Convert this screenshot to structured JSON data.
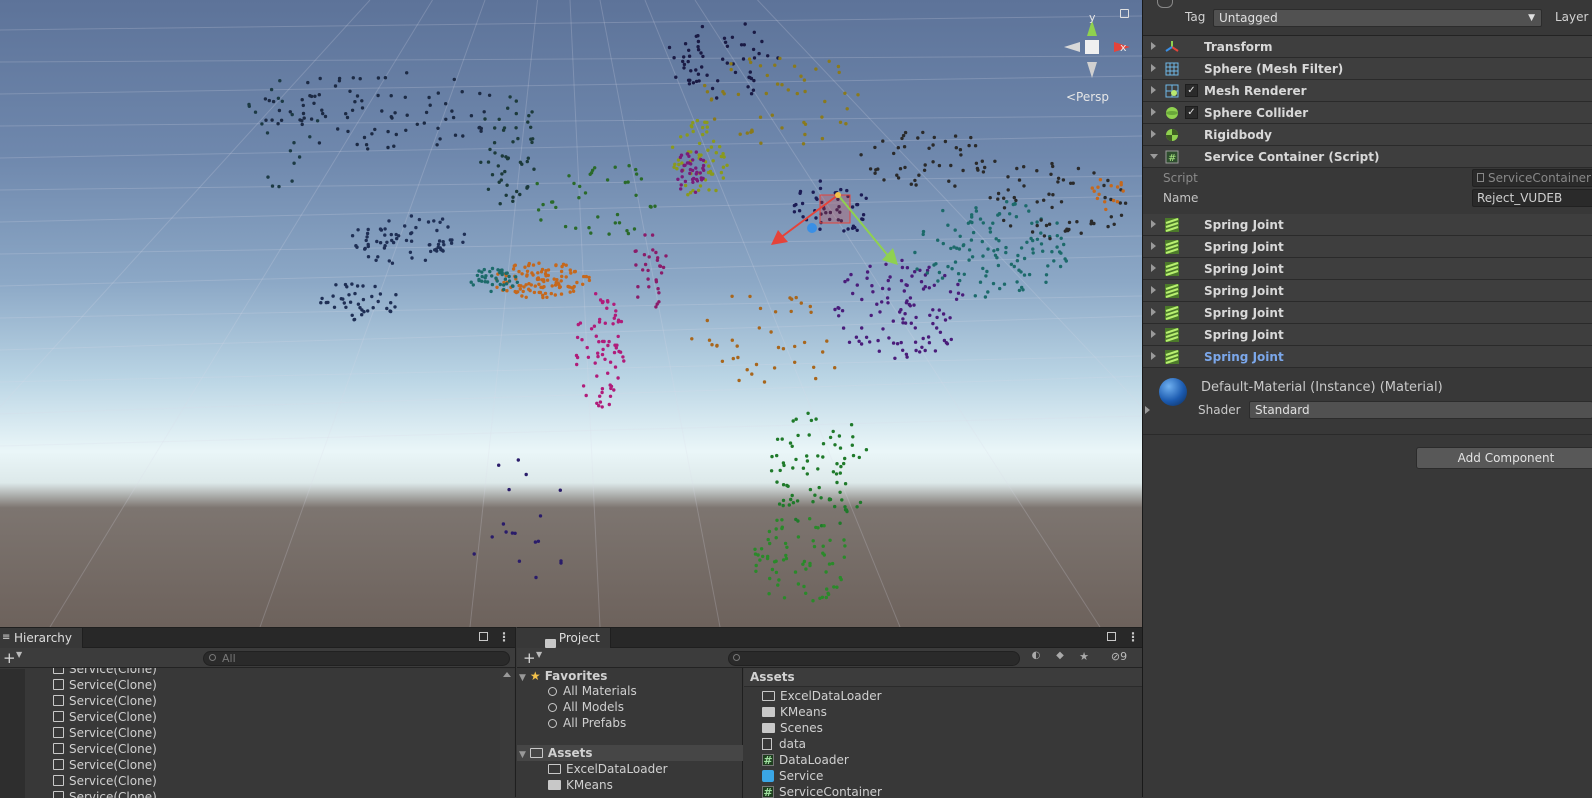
{
  "scene": {
    "persp_label": "<Persp",
    "gizmo_axes": {
      "y": "y",
      "x": "x"
    },
    "lock_icon": "lock-icon"
  },
  "inspector": {
    "tag_label": "Tag",
    "tag_value": "Untagged",
    "layer_label": "Layer",
    "components": [
      {
        "label": "Transform",
        "icon": "transform-icon",
        "checkbox": false,
        "open": false
      },
      {
        "label": "Sphere (Mesh Filter)",
        "icon": "mesh-filter-icon",
        "checkbox": false,
        "open": false
      },
      {
        "label": "Mesh Renderer",
        "icon": "mesh-renderer-icon",
        "checkbox": true,
        "open": false
      },
      {
        "label": "Sphere Collider",
        "icon": "sphere-collider-icon",
        "checkbox": true,
        "open": false
      },
      {
        "label": "Rigidbody",
        "icon": "rigidbody-icon",
        "checkbox": false,
        "open": false
      },
      {
        "label": "Service Container (Script)",
        "icon": "script-icon",
        "checkbox": false,
        "open": true
      }
    ],
    "script_fields": [
      {
        "label": "Script",
        "value": "ServiceContainer",
        "dim": true
      },
      {
        "label": "Name",
        "value": "Reject_VUDEB",
        "dim": false
      }
    ],
    "spring_joints": [
      "Spring Joint",
      "Spring Joint",
      "Spring Joint",
      "Spring Joint",
      "Spring Joint",
      "Spring Joint",
      "Spring Joint"
    ],
    "material_title": "Default-Material (Instance) (Material)",
    "shader_label": "Shader",
    "shader_value": "Standard",
    "add_component": "Add Component"
  },
  "hierarchy": {
    "tab": "Hierarchy",
    "search_placeholder": "All",
    "items": [
      "Service(Clone)",
      "Service(Clone)",
      "Service(Clone)",
      "Service(Clone)",
      "Service(Clone)",
      "Service(Clone)",
      "Service(Clone)",
      "Service(Clone)",
      "Service(Clone)"
    ]
  },
  "project": {
    "tab": "Project",
    "hidden_count": "9",
    "favorites_label": "Favorites",
    "favorites": [
      "All Materials",
      "All Models",
      "All Prefabs"
    ],
    "tree_assets_label": "Assets",
    "tree_assets": [
      "ExcelDataLoader",
      "KMeans"
    ],
    "assets_header": "Assets",
    "assets": [
      {
        "name": "ExcelDataLoader",
        "icon": "folder-icon"
      },
      {
        "name": "KMeans",
        "icon": "folder-filled-icon"
      },
      {
        "name": "Scenes",
        "icon": "folder-filled-icon"
      },
      {
        "name": "data",
        "icon": "document-icon"
      },
      {
        "name": "DataLoader",
        "icon": "script-icon"
      },
      {
        "name": "Service",
        "icon": "prefab-icon"
      },
      {
        "name": "ServiceContainer",
        "icon": "script-icon"
      }
    ]
  }
}
